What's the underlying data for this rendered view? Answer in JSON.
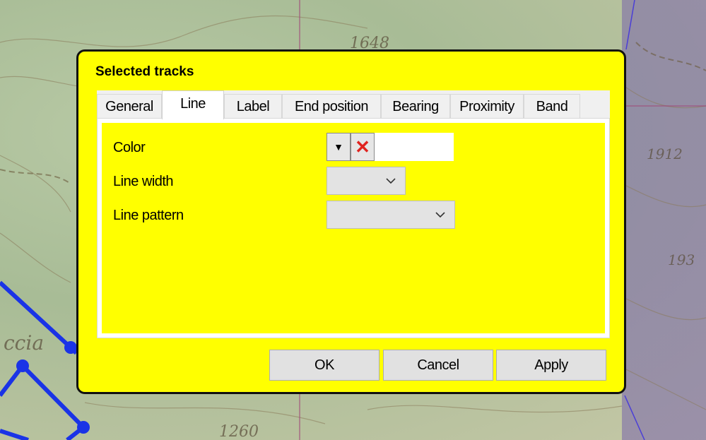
{
  "map": {
    "labels": [
      "1648",
      "1912",
      "193",
      "ccia",
      "1260"
    ]
  },
  "dialog": {
    "title": "Selected tracks",
    "tabs": [
      {
        "label": "General"
      },
      {
        "label": "Line"
      },
      {
        "label": "Label"
      },
      {
        "label": "End position"
      },
      {
        "label": "Bearing"
      },
      {
        "label": "Proximity"
      },
      {
        "label": "Band"
      }
    ],
    "active_tab": "Line",
    "fields": {
      "color_label": "Color",
      "line_width_label": "Line width",
      "line_pattern_label": "Line pattern",
      "color_value": "",
      "line_width_value": "",
      "line_pattern_value": ""
    },
    "buttons": {
      "ok": "OK",
      "cancel": "Cancel",
      "apply": "Apply"
    }
  },
  "colors": {
    "dialog_bg": "#ffff00",
    "track": "#1a33e6",
    "clear_icon": "#e0231f"
  }
}
